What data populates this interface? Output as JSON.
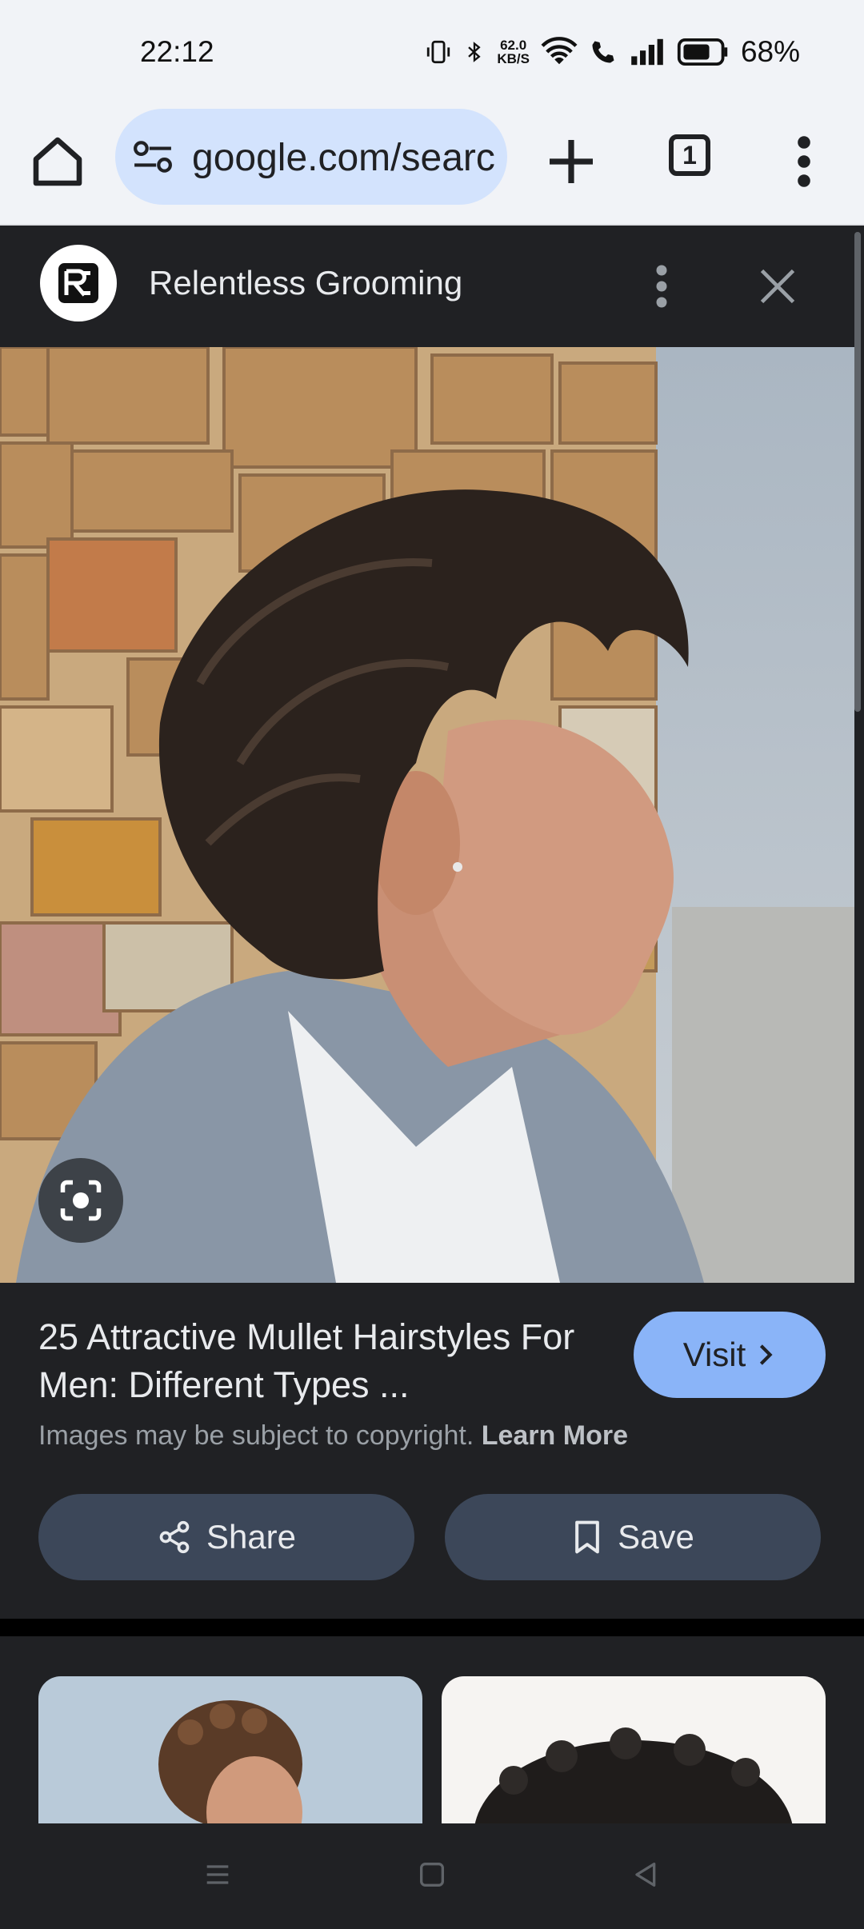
{
  "status_bar": {
    "time": "22:12",
    "net_speed_value": "62.0",
    "net_speed_unit": "KB/S",
    "battery_percent": "68%"
  },
  "toolbar": {
    "url": "google.com/search",
    "tab_count": "1"
  },
  "panel": {
    "source_name": "Relentless Grooming",
    "result_title": "25 Attractive Mullet Hairstyles For Men: Different Types ...",
    "visit_label": "Visit",
    "copyright_text": "Images may be subject to copyright.",
    "learn_more_label": "Learn More",
    "share_label": "Share",
    "save_label": "Save"
  },
  "colors": {
    "accent": "#8ab4f8",
    "panel_bg": "#202124",
    "button_bg": "#3c4759",
    "chrome_bg": "#f1f3f7"
  },
  "icons": [
    "home-icon",
    "tune-icon",
    "plus-icon",
    "tabs-icon",
    "more-vert-icon",
    "close-icon",
    "lens-icon",
    "chevron-right-icon",
    "share-icon",
    "bookmark-icon",
    "menu-icon",
    "home-square-icon",
    "back-icon"
  ]
}
